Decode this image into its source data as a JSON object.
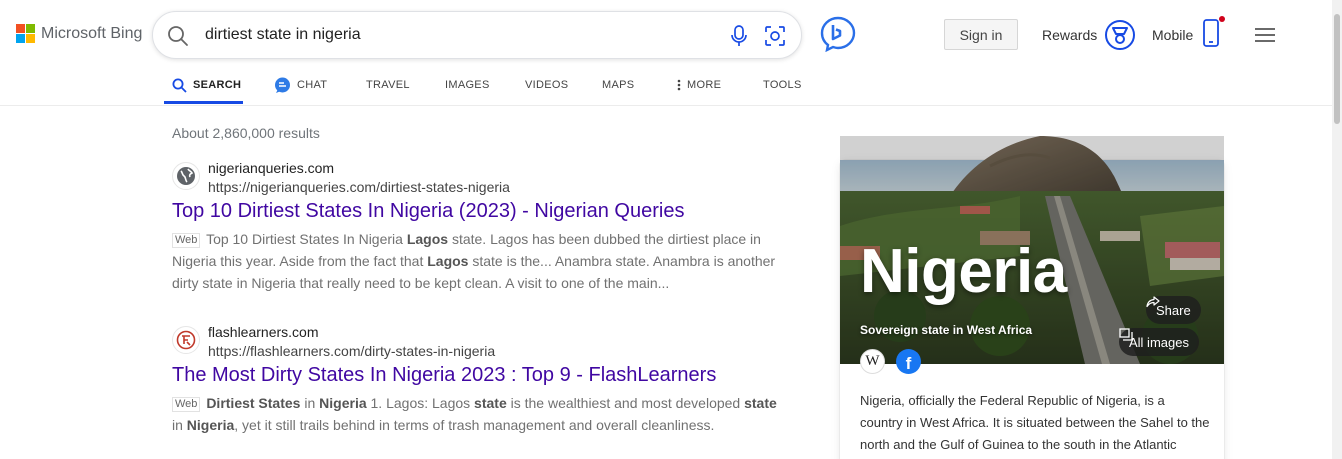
{
  "brand": {
    "logo_text": "Microsoft Bing",
    "colors": [
      "#f25022",
      "#7fba00",
      "#00a4ef",
      "#ffb900"
    ]
  },
  "search": {
    "query": "dirtiest state in nigeria",
    "icons": [
      "search-icon",
      "microphone-icon",
      "visual-search-icon"
    ]
  },
  "header": {
    "sign_in": "Sign in",
    "rewards": "Rewards",
    "mobile": "Mobile",
    "accent": "#174ae4"
  },
  "tabs": [
    {
      "label": "SEARCH",
      "icon": "search-icon",
      "active": true
    },
    {
      "label": "CHAT",
      "icon": "chat-icon",
      "active": false
    },
    {
      "label": "TRAVEL",
      "active": false
    },
    {
      "label": "IMAGES",
      "active": false
    },
    {
      "label": "VIDEOS",
      "active": false
    },
    {
      "label": "MAPS",
      "active": false
    },
    {
      "label": "MORE",
      "icon": "more-vertical-icon",
      "active": false
    },
    {
      "label": "TOOLS",
      "active": false
    }
  ],
  "results_count": "About 2,860,000 results",
  "results": [
    {
      "site_name": "nigerianqueries.com",
      "url": "https://nigerianqueries.com/dirtiest-states-nigeria",
      "title": "Top 10 Dirtiest States In Nigeria (2023) - Nigerian Queries",
      "tag": "Web",
      "favicon": "globe-icon",
      "snippet_html": "Top 10 Dirtiest States In Nigeria <b>Lagos</b> state. Lagos has been dubbed the dirtiest place in Nigeria this year. Aside from the fact that <b>Lagos</b> state is the... Anambra state. Anambra is another dirty state in Nigeria that really need to be kept clean. A visit to one of the main..."
    },
    {
      "site_name": "flashlearners.com",
      "url": "https://flashlearners.com/dirty-states-in-nigeria",
      "title": "The Most Dirty States In Nigeria 2023 : Top 9 - FlashLearners",
      "tag": "Web",
      "favicon": "flashlearners-logo-icon",
      "snippet_html": "<b>Dirtiest States</b> in <b>Nigeria</b> 1. Lagos: Lagos <b>state</b> is the wealthiest and most developed <b>state</b> in <b>Nigeria</b>, yet it still trails behind in terms of trash management and overall cleanliness."
    }
  ],
  "panel": {
    "title": "Nigeria",
    "subtitle": "Sovereign state in West Africa",
    "share": "Share",
    "all_images": "All images",
    "description": "Nigeria, officially the Federal Republic of Nigeria, is a country in West Africa. It is situated between the Sahel to the north and the Gulf of Guinea to the south in the Atlantic",
    "sources": [
      "wikipedia-icon",
      "facebook-icon"
    ]
  }
}
